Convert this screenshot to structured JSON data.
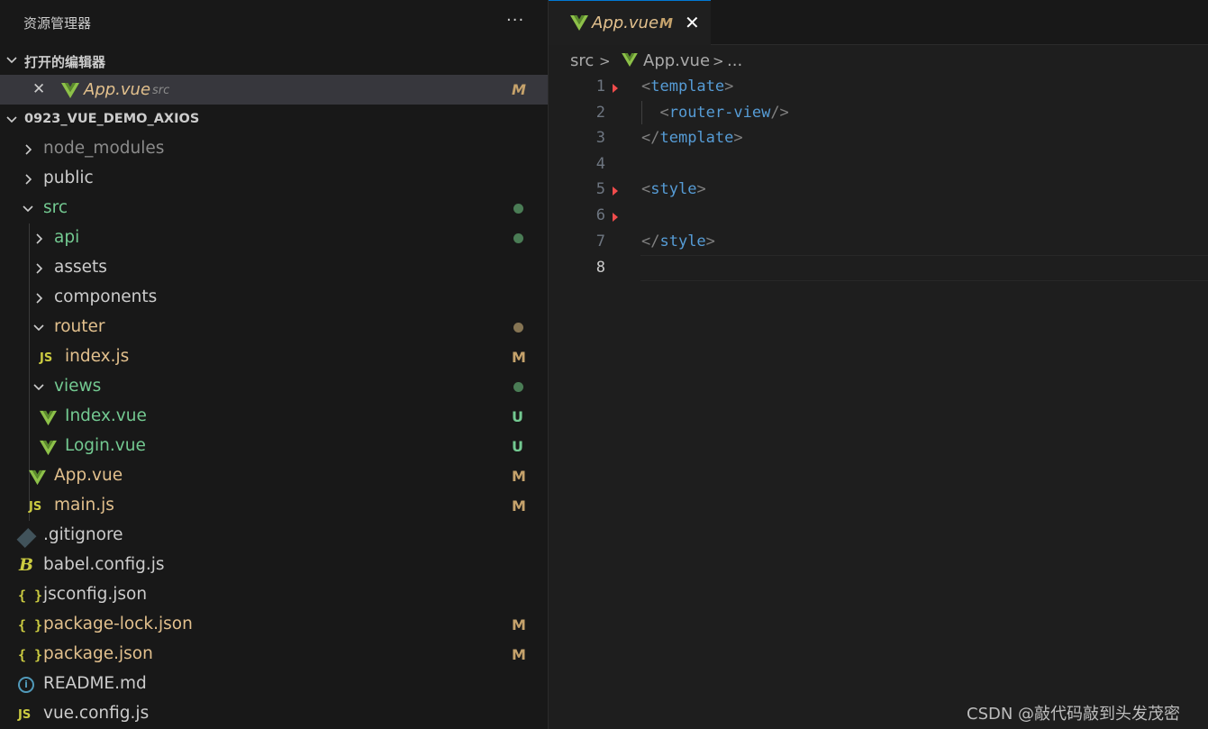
{
  "explorer": {
    "title": "资源管理器",
    "more_label": "···"
  },
  "open_editors": {
    "section_label": "打开的编辑器",
    "items": [
      {
        "name": "App.vue",
        "description": "src",
        "status": "M",
        "icon": "vue-icon"
      }
    ]
  },
  "project": {
    "section_label": "0923_VUE_DEMO_AXIOS"
  },
  "tree": [
    {
      "name": "node_modules",
      "kind": "folder",
      "expanded": false,
      "depth": 0,
      "color": "#8b8b8b"
    },
    {
      "name": "public",
      "kind": "folder",
      "expanded": false,
      "depth": 0,
      "color": "#cccccc"
    },
    {
      "name": "src",
      "kind": "folder",
      "expanded": true,
      "depth": 0,
      "color": "#73c991",
      "dot": "#4a7c55"
    },
    {
      "name": "api",
      "kind": "folder",
      "expanded": false,
      "depth": 1,
      "color": "#73c991",
      "dot": "#4a7c55"
    },
    {
      "name": "assets",
      "kind": "folder",
      "expanded": false,
      "depth": 1,
      "color": "#cccccc"
    },
    {
      "name": "components",
      "kind": "folder",
      "expanded": false,
      "depth": 1,
      "color": "#cccccc"
    },
    {
      "name": "router",
      "kind": "folder",
      "expanded": true,
      "depth": 1,
      "color": "#e2c08d",
      "dot": "#857453"
    },
    {
      "name": "index.js",
      "kind": "file",
      "icon": "js-icon",
      "depth": 2,
      "color": "#e2c08d",
      "status": "M",
      "status_color": "#c5a26b"
    },
    {
      "name": "views",
      "kind": "folder",
      "expanded": true,
      "depth": 1,
      "color": "#73c991",
      "dot": "#4a7c55"
    },
    {
      "name": "Index.vue",
      "kind": "file",
      "icon": "vue-icon",
      "depth": 2,
      "color": "#73c991",
      "status": "U",
      "status_color": "#73c991"
    },
    {
      "name": "Login.vue",
      "kind": "file",
      "icon": "vue-icon",
      "depth": 2,
      "color": "#73c991",
      "status": "U",
      "status_color": "#73c991"
    },
    {
      "name": "App.vue",
      "kind": "file",
      "icon": "vue-icon",
      "depth": 1,
      "color": "#e2c08d",
      "status": "M",
      "status_color": "#c5a26b"
    },
    {
      "name": "main.js",
      "kind": "file",
      "icon": "js-icon",
      "depth": 1,
      "color": "#e2c08d",
      "status": "M",
      "status_color": "#c5a26b"
    },
    {
      "name": ".gitignore",
      "kind": "file",
      "icon": "git-icon",
      "depth": 0,
      "color": "#cccccc"
    },
    {
      "name": "babel.config.js",
      "kind": "file",
      "icon": "babel-icon",
      "depth": 0,
      "color": "#cccccc"
    },
    {
      "name": "jsconfig.json",
      "kind": "file",
      "icon": "json-icon",
      "depth": 0,
      "color": "#cccccc"
    },
    {
      "name": "package-lock.json",
      "kind": "file",
      "icon": "json-icon",
      "depth": 0,
      "color": "#e2c08d",
      "status": "M",
      "status_color": "#c5a26b"
    },
    {
      "name": "package.json",
      "kind": "file",
      "icon": "json-icon",
      "depth": 0,
      "color": "#e2c08d",
      "status": "M",
      "status_color": "#c5a26b"
    },
    {
      "name": "README.md",
      "kind": "file",
      "icon": "info-icon",
      "depth": 0,
      "color": "#cccccc"
    },
    {
      "name": "vue.config.js",
      "kind": "file",
      "icon": "js-icon",
      "depth": 0,
      "color": "#cccccc"
    }
  ],
  "icon_text": {
    "js": "JS",
    "json": "{ }",
    "babel": "B",
    "info": "i"
  },
  "editor": {
    "tab": {
      "name": "App.vue",
      "status": "M",
      "close": "✕"
    },
    "breadcrumb": [
      "src",
      ">",
      "App.vue",
      ">",
      "..."
    ],
    "current_line": 8,
    "lines": [
      {
        "n": "1",
        "fold": true,
        "tokens": [
          [
            "punc",
            "<"
          ],
          [
            "tagn",
            "template"
          ],
          [
            "punc",
            ">"
          ]
        ]
      },
      {
        "n": "2",
        "fold": false,
        "tokens": [
          [
            "punc",
            "  <"
          ],
          [
            "tagn",
            "router-view"
          ],
          [
            "punc",
            "/>"
          ]
        ]
      },
      {
        "n": "3",
        "fold": false,
        "tokens": [
          [
            "punc",
            "</"
          ],
          [
            "tagn",
            "template"
          ],
          [
            "punc",
            ">"
          ]
        ]
      },
      {
        "n": "4",
        "fold": false,
        "tokens": []
      },
      {
        "n": "5",
        "fold": true,
        "tokens": [
          [
            "punc",
            "<"
          ],
          [
            "tagn",
            "style"
          ],
          [
            "punc",
            ">"
          ]
        ]
      },
      {
        "n": "6",
        "fold": true,
        "tokens": []
      },
      {
        "n": "7",
        "fold": false,
        "tokens": [
          [
            "punc",
            "</"
          ],
          [
            "tagn",
            "style"
          ],
          [
            "punc",
            ">"
          ]
        ]
      },
      {
        "n": "8",
        "fold": false,
        "tokens": []
      }
    ]
  },
  "watermark": "CSDN @敲代码敲到头发茂密",
  "colors": {
    "accent": "#0078d4",
    "vue_green": "#8dc149",
    "modified": "#e2c08d",
    "untracked": "#73c991"
  }
}
